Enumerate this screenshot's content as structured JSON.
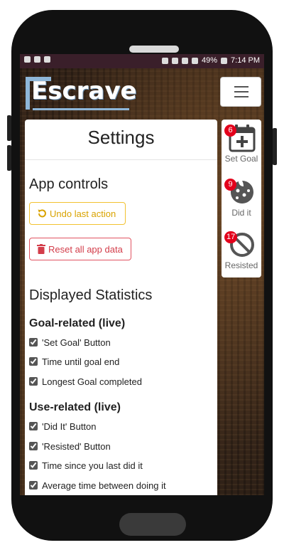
{
  "status_bar": {
    "battery": "49%",
    "time": "7:14 PM"
  },
  "app": {
    "logo_text": "Escrave",
    "menu_icon": "hamburger-icon"
  },
  "side_nav": [
    {
      "label": "Set Goal",
      "badge": "6",
      "icon": "calendar-plus-icon"
    },
    {
      "label": "Did it",
      "badge": "9",
      "icon": "cookie-icon"
    },
    {
      "label": "Resisted",
      "badge": "17",
      "icon": "ban-icon"
    }
  ],
  "settings": {
    "title": "Settings",
    "app_controls_heading": "App controls",
    "undo_label": "Undo last action",
    "reset_label": "Reset all app data",
    "stats_heading": "Displayed Statistics",
    "goal_heading": "Goal-related (live)",
    "goal_items": [
      {
        "label": "'Set Goal' Button",
        "checked": true
      },
      {
        "label": "Time until goal end",
        "checked": true
      },
      {
        "label": "Longest Goal completed",
        "checked": true
      }
    ],
    "use_heading": "Use-related (live)",
    "use_items": [
      {
        "label": "'Did It' Button",
        "checked": true
      },
      {
        "label": "'Resisted' Button",
        "checked": true
      },
      {
        "label": "Time since you last did it",
        "checked": true
      },
      {
        "label": "Average time between doing it",
        "checked": true
      }
    ]
  },
  "colors": {
    "badge": "#e3001b",
    "undo": "#d9a300",
    "reset": "#d33d4a",
    "statusbar": "#3a1f2a"
  }
}
